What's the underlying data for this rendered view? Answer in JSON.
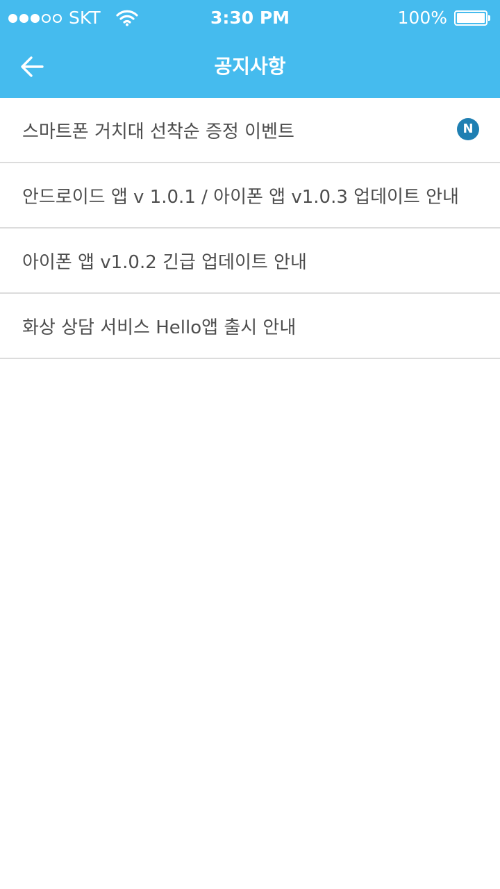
{
  "status_bar": {
    "carrier": "SKT",
    "time": "3:30 PM",
    "battery_text": "100%",
    "signal_strength": 3,
    "signal_max": 5,
    "battery_level": 1.0,
    "icons": [
      "signal-icon",
      "wifi-icon",
      "battery-icon"
    ]
  },
  "nav": {
    "title": "공지사항",
    "back_icon": "arrow-left-icon"
  },
  "colors": {
    "header_bg": "#45bbee",
    "badge_bg": "#1f7fb2",
    "divider": "#dcdcdc",
    "text": "#4d4d4d"
  },
  "notices": [
    {
      "title": "스마트폰 거치대 선착순 증정 이벤트",
      "badge": "N"
    },
    {
      "title": "안드로이드 앱 v 1.0.1 / 아이폰 앱 v1.0.3 업데이트 안내",
      "badge": null
    },
    {
      "title": "아이폰 앱 v1.0.2 긴급 업데이트 안내",
      "badge": null
    },
    {
      "title": "화상 상담 서비스 Hello앱 출시 안내",
      "badge": null
    }
  ]
}
